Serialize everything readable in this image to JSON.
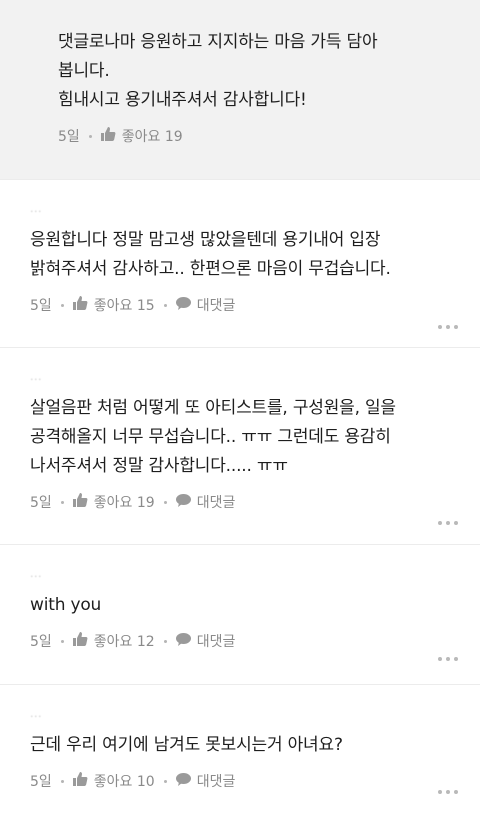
{
  "comments": [
    {
      "type": "reply",
      "author": "",
      "text": "댓글로나마 응원하고 지지하는 마음 가득 담아\n봅니다.\n힘내시고 용기내주셔서 감사합니다!",
      "time": "5일",
      "like_label": "좋아요 19",
      "has_reply_btn": false
    },
    {
      "type": "normal",
      "author": "...",
      "text": "응원합니다 정말 맘고생 많았을텐데 용기내어 입장\n밝혀주셔서 감사하고.. 한편으론 마음이 무겁습니다.",
      "time": "5일",
      "like_label": "좋아요 15",
      "reply_label": "대댓글"
    },
    {
      "type": "normal",
      "author": "...",
      "text": "살얼음판 처럼 어떻게 또 아티스트를, 구성원을, 일을\n공격해올지 너무 무섭습니다.. ㅠㅠ 그런데도 용감히\n나서주셔서 정말 감사합니다..... ㅠㅠ",
      "time": "5일",
      "like_label": "좋아요 19",
      "reply_label": "대댓글"
    },
    {
      "type": "normal",
      "author": "...",
      "text": "with you",
      "time": "5일",
      "like_label": "좋아요 12",
      "reply_label": "대댓글"
    },
    {
      "type": "normal",
      "author": "...",
      "text": "근데 우리 여기에 남겨도 못보시는거 아녀요?",
      "time": "5일",
      "like_label": "좋아요 10",
      "reply_label": "대댓글"
    }
  ],
  "icons": {
    "like": "thumbs-up-icon",
    "reply": "speech-bubble-icon",
    "more": "more-dots-icon"
  },
  "colors": {
    "reply_bg": "#f2f2f2",
    "meta_text": "#8a8a8a",
    "divider": "#ececec"
  }
}
